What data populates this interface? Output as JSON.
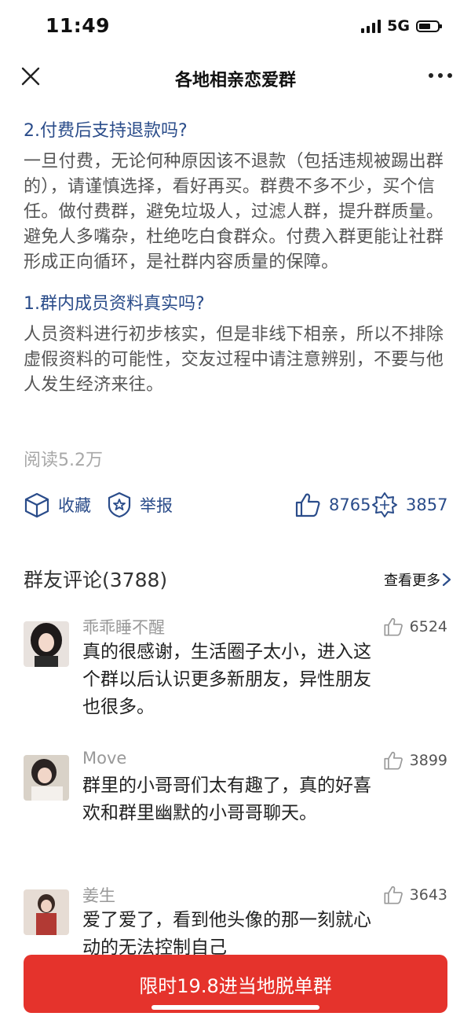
{
  "status_bar": {
    "time": "11:49",
    "network": "5G"
  },
  "nav": {
    "title": "各地相亲恋爱群"
  },
  "article": {
    "faq": [
      {
        "question": "2.付费后支持退款吗?",
        "answer": "一旦付费，无论何种原因该不退款（包括违规被踢出群的），请谨慎选择，看好再买。群费不多不少，买个信任。做付费群，避免垃圾人，过滤人群，提升群质量。避免人多嘴杂，杜绝吃白食群众。付费入群更能让社群形成正向循环，是社群内容质量的保障。"
      },
      {
        "question": "1.群内成员资料真实吗?",
        "answer": "人员资料进行初步核实，但是非线下相亲，所以不排除虚假资料的可能性，交友过程中请注意辨别，不要与他人发生经济来往。"
      }
    ],
    "read_count": "阅读5.2万"
  },
  "actions": {
    "favorite_label": "收藏",
    "report_label": "举报",
    "like_count": "8765",
    "share_count": "3857"
  },
  "comments": {
    "title": "群友评论(3788)",
    "view_more": "查看更多",
    "items": [
      {
        "name": "乖乖睡不醒",
        "likes": "6524",
        "text": "真的很感谢，生活圈子太小，进入这个群以后认识更多新朋友，异性朋友也很多。"
      },
      {
        "name": "Move",
        "likes": "3899",
        "text": "群里的小哥哥们太有趣了，真的好喜欢和群里幽默的小哥哥聊天。"
      },
      {
        "name": "姜生",
        "likes": "3643",
        "text": "爱了爱了，看到他头像的那一刻就心动的无法控制自己"
      }
    ]
  },
  "cta": {
    "label": "限时19.8进当地脱单群"
  },
  "colors": {
    "accent": "#2a4c8a",
    "cta": "#e5332c"
  }
}
